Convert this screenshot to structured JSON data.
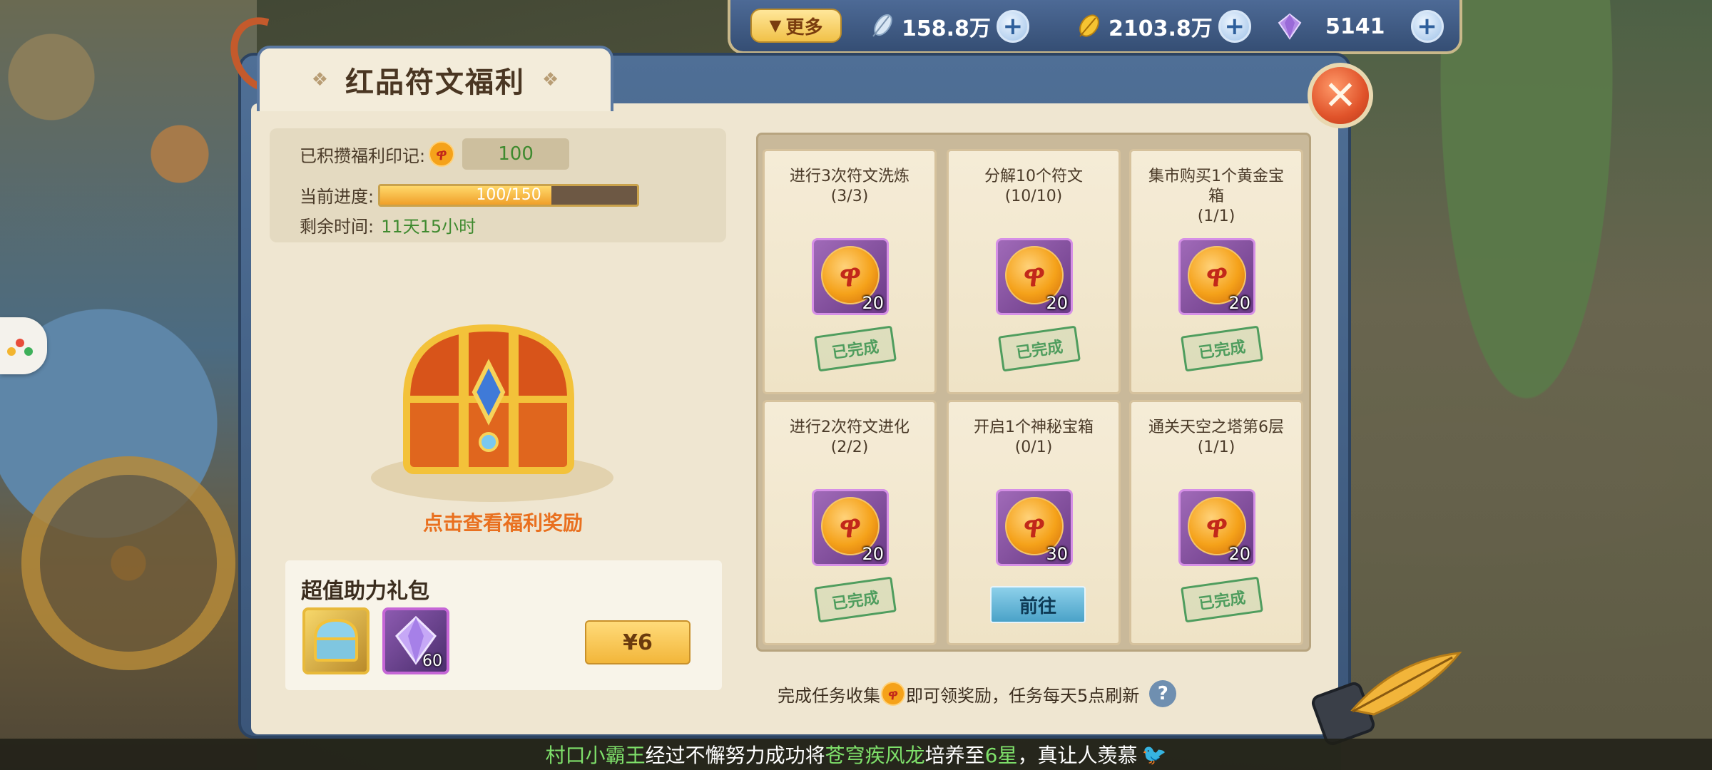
{
  "top_bar": {
    "more_label": "更多",
    "currencies": [
      {
        "icon": "feather-icon",
        "value": "158.8万"
      },
      {
        "icon": "gold-leaf-icon",
        "value": "2103.8万"
      },
      {
        "icon": "diamond-icon",
        "value": "5141"
      }
    ],
    "plus_symbol": "+"
  },
  "panel": {
    "title": "红品符文福利",
    "close_symbol": "✕"
  },
  "info": {
    "seal_label": "已积攒福利印记:",
    "seal_value": "100",
    "progress_label": "当前进度:",
    "progress_text": "100/150",
    "progress_fraction": 0.667,
    "time_label": "剩余时间:",
    "time_value": "11天15小时"
  },
  "chest": {
    "caption": "点击查看福利奖励"
  },
  "gift": {
    "title": "超值助力礼包",
    "items": [
      {
        "icon": "treasure-chest-icon",
        "count": ""
      },
      {
        "icon": "crystal-icon",
        "count": "60"
      }
    ],
    "price": "¥6"
  },
  "tasks": [
    {
      "title": "进行3次符文洗炼",
      "progress": "(3/3)",
      "reward": "20",
      "status": "已完成"
    },
    {
      "title": "分解10个符文",
      "progress": "(10/10)",
      "reward": "20",
      "status": "已完成"
    },
    {
      "title": "集市购买1个黄金宝箱",
      "progress": "(1/1)",
      "reward": "20",
      "status": "已完成"
    },
    {
      "title": "进行2次符文进化",
      "progress": "(2/2)",
      "reward": "20",
      "status": "已完成"
    },
    {
      "title": "开启1个神秘宝箱",
      "progress": "(0/1)",
      "reward": "30",
      "status": "前往"
    },
    {
      "title": "通关天空之塔第6层",
      "progress": "(1/1)",
      "reward": "20",
      "status": "已完成"
    }
  ],
  "note": {
    "before": "完成任务收集",
    "after": "即可领奖励，任务每天5点刷新",
    "help": "?"
  },
  "ticker": {
    "player": "村口小霸王",
    "text1": "经过不懈努力成功将",
    "pet": "苍穹疾风龙",
    "text2": "培养至",
    "level": "6星",
    "text3": "，真让人羡慕"
  }
}
